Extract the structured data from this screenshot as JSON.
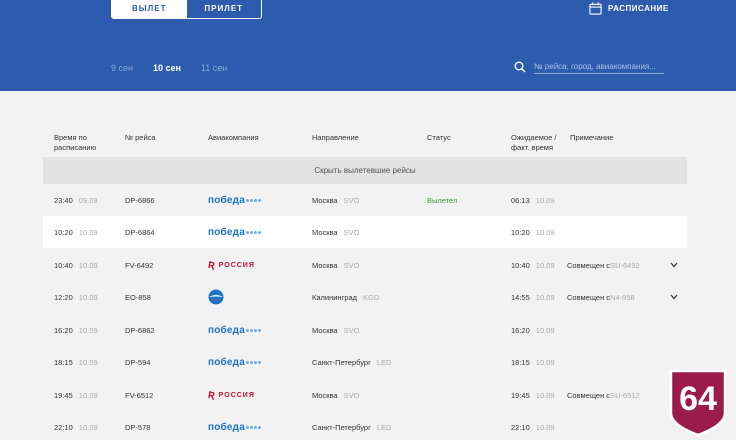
{
  "header": {
    "tabs": [
      {
        "label": "ВЫЛЕТ",
        "active": true
      },
      {
        "label": "ПРИЛЕТ",
        "active": false
      }
    ],
    "schedule_label": "РАСПИСАНИЕ",
    "dates": [
      {
        "label": "9 сен",
        "active": false
      },
      {
        "label": "10 сен",
        "active": true
      },
      {
        "label": "11 сен",
        "active": false
      }
    ],
    "search_placeholder": "№ рейса, город, авиакомпания..."
  },
  "table": {
    "columns": {
      "sched_line1": "Время по",
      "sched_line2": "расписанию",
      "flight": "№ рейса",
      "airline": "Авиакомпания",
      "direction": "Направление",
      "status": "Статус",
      "expected_line1": "Ожидаемое /",
      "expected_line2": "факт. время",
      "note": "Примечание"
    },
    "hide_departed": "Скрыть вылетевшие рейсы",
    "rows": [
      {
        "time": "23:40",
        "date": "09.09",
        "flight": "DP-6866",
        "airline": "pobeda",
        "city": "Москва",
        "code": "SVO",
        "status": "Вылетел",
        "exp_time": "06:13",
        "exp_date": "10.09",
        "note": "",
        "note_code": ""
      },
      {
        "time": "10:20",
        "date": "10.09",
        "flight": "DP-6864",
        "airline": "pobeda",
        "city": "Москва",
        "code": "SVO",
        "status": "",
        "exp_time": "10:20",
        "exp_date": "10.09",
        "note": "",
        "note_code": ""
      },
      {
        "time": "10:40",
        "date": "10.09",
        "flight": "FV-6492",
        "airline": "rossiya",
        "city": "Москва",
        "code": "SVO",
        "status": "",
        "exp_time": "10:40",
        "exp_date": "10.09",
        "note": "Совмещен с ",
        "note_code": "SU-6492"
      },
      {
        "time": "12:20",
        "date": "10.09",
        "flight": "EO-858",
        "airline": "pegas",
        "city": "Калининград",
        "code": "KGD",
        "status": "",
        "exp_time": "14:55",
        "exp_date": "10.09",
        "note": "Совмещен с ",
        "note_code": "N4-858"
      },
      {
        "time": "16:20",
        "date": "10.09",
        "flight": "DP-6862",
        "airline": "pobeda",
        "city": "Москва",
        "code": "SVO",
        "status": "",
        "exp_time": "16:20",
        "exp_date": "10.09",
        "note": "",
        "note_code": ""
      },
      {
        "time": "18:15",
        "date": "10.09",
        "flight": "DP-594",
        "airline": "pobeda",
        "city": "Санкт-Петербург",
        "code": "LED",
        "status": "",
        "exp_time": "18:15",
        "exp_date": "10.09",
        "note": "",
        "note_code": ""
      },
      {
        "time": "19:45",
        "date": "10.09",
        "flight": "FV-6512",
        "airline": "rossiya",
        "city": "Москва",
        "code": "SVO",
        "status": "",
        "exp_time": "19:45",
        "exp_date": "10.09",
        "note": "Совмещен с ",
        "note_code": "SU-6512"
      },
      {
        "time": "22:10",
        "date": "10.09",
        "flight": "DP-578",
        "airline": "pobeda",
        "city": "Санкт-Петербург",
        "code": "LED",
        "status": "",
        "exp_time": "22:10",
        "exp_date": "10.09",
        "note": "",
        "note_code": ""
      }
    ]
  },
  "airline_logos": {
    "pobeda": "победа",
    "rossiya": "РОССИЯ"
  },
  "badge": {
    "text": "64"
  },
  "colors": {
    "header_bg": "#2d5caf",
    "status_green": "#3c9a3c",
    "badge_bg": "#9b1b4b"
  }
}
